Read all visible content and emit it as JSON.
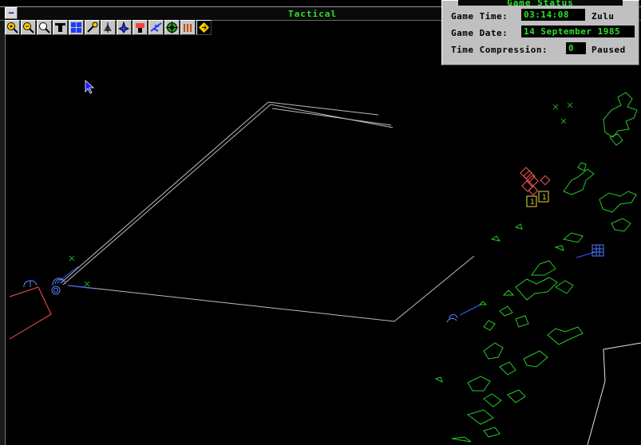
{
  "window": {
    "title": "Tactical",
    "system_button": "−"
  },
  "toolbar": {
    "buttons": [
      {
        "name": "zoom-in-icon"
      },
      {
        "name": "zoom-out-icon"
      },
      {
        "name": "magnify-icon"
      },
      {
        "name": "filter-icon"
      },
      {
        "name": "range-rings-icon"
      },
      {
        "name": "sensor-icon"
      },
      {
        "name": "radar-icon"
      },
      {
        "name": "unit-icon"
      },
      {
        "name": "weapon-icon"
      },
      {
        "name": "aircraft-icon"
      },
      {
        "name": "target-icon"
      },
      {
        "name": "missile-icon"
      },
      {
        "name": "goto-icon"
      }
    ]
  },
  "game_status": {
    "title": "Game Status",
    "time_label": "Game Time:",
    "time_value": "03:14:08",
    "time_zone": "Zulu",
    "date_label": "Game Date:",
    "date_value": "14 September 1985",
    "compression_label": "Time Compression:",
    "compression_value": "0",
    "state": "Paused"
  },
  "map": {
    "unit_markers": [
      "1",
      "1"
    ],
    "colors": {
      "coast": "#28c828",
      "track": "#bcbcbc",
      "friendly": "#4f78ff",
      "hostile": "#ff5050",
      "unknown": "#e6dc3c",
      "contact": "#1fa01f"
    }
  }
}
